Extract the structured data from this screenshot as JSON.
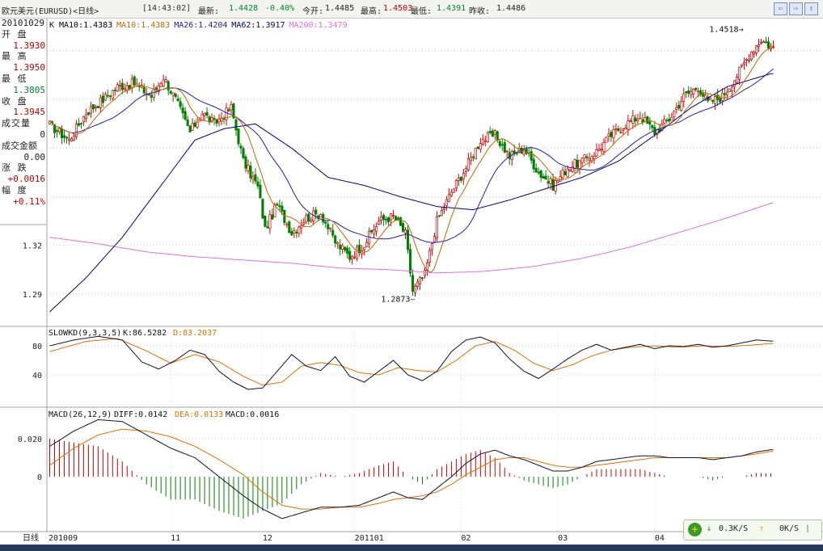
{
  "header": {
    "symbol": "欧元美元(EURUSD)<日线>",
    "time": "[14:43:02]",
    "latest_label": "最新:",
    "latest": "1.4428",
    "change": "-0.40%",
    "open_label": "今开:",
    "open": "1.4485",
    "high_label": "最高:",
    "high": "1.4503",
    "low_label": "最低:",
    "low": "1.4391",
    "prev_close_label": "昨收:",
    "prev_close": "1.4486"
  },
  "window_buttons": [
    "⇦",
    "⇨",
    "⇧"
  ],
  "info_panel": {
    "date": "20101029",
    "open_label": "开 盘",
    "open": "1.3930",
    "high_label": "最 高",
    "high": "1.3950",
    "low_label": "最 低",
    "low": "1.3805",
    "close_label": "收 盘",
    "close": "1.3945",
    "volume_label": "成交量",
    "volume": "0",
    "amount_label": "成交金额",
    "amount": "0.00",
    "change_label": "涨 跌",
    "change": "+0.0016",
    "range_label": "幅 度",
    "range": "+0.11%"
  },
  "colors": {
    "up": "#d40000",
    "down": "#008000",
    "ma10": "#c86400",
    "ma26": "#2222aa",
    "ma62": "#000080",
    "ma200": "#e070e0",
    "k_line": "#111133",
    "d_line": "#e07000"
  },
  "net_widget": {
    "icon": "plus-icon",
    "down_arrow": "↓",
    "down_speed": "0.3K/S",
    "up_arrow": "↑",
    "up_speed": "0K/S",
    "sep": "|"
  },
  "chart_data": [
    {
      "type": "candlestick",
      "legend_prefix": "K",
      "legend": [
        {
          "name": "MA10",
          "value": "1.4383",
          "color": "#000000"
        },
        {
          "name": "MA10",
          "value": "1.4383",
          "color": "#c86400"
        },
        {
          "name": "MA26",
          "value": "1.4204",
          "color": "#2222aa"
        },
        {
          "name": "MA62",
          "value": "1.3917",
          "color": "#000080"
        },
        {
          "name": "MA200",
          "value": "1.3479",
          "color": "#e070e0"
        }
      ],
      "y_ticks": [
        "1.32",
        "1.29"
      ],
      "ylim": [
        1.27,
        1.46
      ],
      "annotations": [
        {
          "text": "1.4518",
          "x": 290,
          "y": 1.4518
        },
        {
          "text": "1.2873",
          "x": 150,
          "y": 1.2873
        }
      ],
      "x_labels": [
        {
          "text": "日线",
          "x": 0
        },
        {
          "text": "201009",
          "x": 0
        },
        {
          "text": "11",
          "x": 50
        },
        {
          "text": "12",
          "x": 88
        },
        {
          "text": "201101",
          "x": 126
        },
        {
          "text": "02",
          "x": 170
        },
        {
          "text": "03",
          "x": 210
        },
        {
          "text": "04",
          "x": 250
        }
      ],
      "close_anchors": [
        [
          0,
          1.3945
        ],
        [
          8,
          1.385
        ],
        [
          15,
          1.402
        ],
        [
          22,
          1.41
        ],
        [
          28,
          1.418
        ],
        [
          35,
          1.42
        ],
        [
          42,
          1.412
        ],
        [
          47,
          1.424
        ],
        [
          52,
          1.41
        ],
        [
          58,
          1.39
        ],
        [
          63,
          1.402
        ],
        [
          68,
          1.395
        ],
        [
          75,
          1.405
        ],
        [
          80,
          1.372
        ],
        [
          86,
          1.356
        ],
        [
          89,
          1.33
        ],
        [
          94,
          1.345
        ],
        [
          100,
          1.328
        ],
        [
          106,
          1.337
        ],
        [
          112,
          1.34
        ],
        [
          118,
          1.322
        ],
        [
          124,
          1.313
        ],
        [
          130,
          1.321
        ],
        [
          136,
          1.335
        ],
        [
          142,
          1.338
        ],
        [
          147,
          1.327
        ],
        [
          150,
          1.292
        ],
        [
          155,
          1.302
        ],
        [
          160,
          1.335
        ],
        [
          166,
          1.353
        ],
        [
          172,
          1.368
        ],
        [
          178,
          1.385
        ],
        [
          184,
          1.388
        ],
        [
          190,
          1.375
        ],
        [
          196,
          1.38
        ],
        [
          202,
          1.365
        ],
        [
          208,
          1.357
        ],
        [
          214,
          1.368
        ],
        [
          220,
          1.372
        ],
        [
          226,
          1.378
        ],
        [
          232,
          1.388
        ],
        [
          238,
          1.395
        ],
        [
          244,
          1.4
        ],
        [
          250,
          1.39
        ],
        [
          256,
          1.398
        ],
        [
          262,
          1.412
        ],
        [
          268,
          1.418
        ],
        [
          272,
          1.408
        ],
        [
          278,
          1.412
        ],
        [
          284,
          1.425
        ],
        [
          290,
          1.44
        ],
        [
          294,
          1.447
        ],
        [
          298,
          1.4428
        ]
      ],
      "ma62_anchors": [
        [
          0,
          1.279
        ],
        [
          15,
          1.3
        ],
        [
          30,
          1.325
        ],
        [
          45,
          1.355
        ],
        [
          60,
          1.385
        ],
        [
          72,
          1.392
        ],
        [
          85,
          1.395
        ],
        [
          100,
          1.38
        ],
        [
          115,
          1.362
        ],
        [
          130,
          1.357
        ],
        [
          145,
          1.35
        ],
        [
          160,
          1.344
        ],
        [
          175,
          1.342
        ],
        [
          190,
          1.348
        ],
        [
          205,
          1.355
        ],
        [
          220,
          1.362
        ],
        [
          235,
          1.372
        ],
        [
          250,
          1.388
        ],
        [
          265,
          1.405
        ],
        [
          280,
          1.418
        ],
        [
          298,
          1.426
        ]
      ],
      "ma200_anchors": [
        [
          0,
          1.325
        ],
        [
          20,
          1.321
        ],
        [
          40,
          1.316
        ],
        [
          60,
          1.313
        ],
        [
          80,
          1.311
        ],
        [
          100,
          1.309
        ],
        [
          120,
          1.306
        ],
        [
          140,
          1.305
        ],
        [
          160,
          1.303
        ],
        [
          180,
          1.304
        ],
        [
          200,
          1.307
        ],
        [
          220,
          1.312
        ],
        [
          240,
          1.319
        ],
        [
          260,
          1.328
        ],
        [
          280,
          1.337
        ],
        [
          298,
          1.346
        ]
      ]
    },
    {
      "type": "line",
      "title": "SLOWKD(9,3,3,5)",
      "series": [
        {
          "name": "K",
          "value": "86.5282"
        },
        {
          "name": "D",
          "value": "83.2037"
        }
      ],
      "y_ticks": [
        "80",
        "40"
      ],
      "ylim": [
        0,
        100
      ],
      "k_anchors": [
        [
          0,
          80
        ],
        [
          10,
          88
        ],
        [
          20,
          93
        ],
        [
          30,
          88
        ],
        [
          38,
          58
        ],
        [
          45,
          48
        ],
        [
          52,
          60
        ],
        [
          58,
          74
        ],
        [
          64,
          68
        ],
        [
          70,
          45
        ],
        [
          76,
          30
        ],
        [
          82,
          20
        ],
        [
          88,
          22
        ],
        [
          94,
          45
        ],
        [
          100,
          68
        ],
        [
          106,
          52
        ],
        [
          112,
          46
        ],
        [
          118,
          65
        ],
        [
          124,
          38
        ],
        [
          130,
          30
        ],
        [
          136,
          45
        ],
        [
          142,
          60
        ],
        [
          148,
          40
        ],
        [
          154,
          32
        ],
        [
          160,
          45
        ],
        [
          166,
          72
        ],
        [
          172,
          88
        ],
        [
          178,
          92
        ],
        [
          184,
          84
        ],
        [
          190,
          62
        ],
        [
          196,
          45
        ],
        [
          202,
          35
        ],
        [
          208,
          48
        ],
        [
          214,
          62
        ],
        [
          220,
          74
        ],
        [
          226,
          82
        ],
        [
          232,
          74
        ],
        [
          238,
          78
        ],
        [
          244,
          82
        ],
        [
          250,
          76
        ],
        [
          256,
          80
        ],
        [
          262,
          79
        ],
        [
          268,
          82
        ],
        [
          274,
          78
        ],
        [
          280,
          80
        ],
        [
          286,
          84
        ],
        [
          292,
          88
        ],
        [
          298,
          86.5
        ]
      ],
      "d_anchors": [
        [
          0,
          72
        ],
        [
          15,
          86
        ],
        [
          28,
          90
        ],
        [
          40,
          73
        ],
        [
          50,
          56
        ],
        [
          60,
          68
        ],
        [
          70,
          58
        ],
        [
          80,
          38
        ],
        [
          88,
          26
        ],
        [
          96,
          30
        ],
        [
          104,
          52
        ],
        [
          112,
          57
        ],
        [
          120,
          53
        ],
        [
          128,
          43
        ],
        [
          136,
          40
        ],
        [
          144,
          50
        ],
        [
          152,
          46
        ],
        [
          160,
          44
        ],
        [
          168,
          60
        ],
        [
          176,
          80
        ],
        [
          184,
          86
        ],
        [
          192,
          74
        ],
        [
          200,
          56
        ],
        [
          208,
          46
        ],
        [
          216,
          54
        ],
        [
          224,
          66
        ],
        [
          232,
          74
        ],
        [
          240,
          78
        ],
        [
          250,
          80
        ],
        [
          260,
          78
        ],
        [
          270,
          80
        ],
        [
          280,
          79
        ],
        [
          290,
          81
        ],
        [
          298,
          83.2
        ]
      ]
    },
    {
      "type": "line+bar",
      "title": "MACD(26,12,9)",
      "series": [
        {
          "name": "DIFF",
          "value": "0.0142"
        },
        {
          "name": "DEA",
          "value": "0.0133"
        },
        {
          "name": "MACD",
          "value": "0.0016"
        }
      ],
      "y_ticks": [
        "0.020",
        "0"
      ],
      "ylim": [
        -0.028,
        0.034
      ],
      "diff_anchors": [
        [
          0,
          0.016
        ],
        [
          10,
          0.024
        ],
        [
          20,
          0.03
        ],
        [
          30,
          0.029
        ],
        [
          40,
          0.022
        ],
        [
          50,
          0.015
        ],
        [
          60,
          0.01
        ],
        [
          70,
          0.0
        ],
        [
          80,
          -0.01
        ],
        [
          88,
          -0.017
        ],
        [
          96,
          -0.022
        ],
        [
          104,
          -0.019
        ],
        [
          112,
          -0.016
        ],
        [
          120,
          -0.016
        ],
        [
          128,
          -0.015
        ],
        [
          136,
          -0.011
        ],
        [
          142,
          -0.008
        ],
        [
          148,
          -0.011
        ],
        [
          154,
          -0.012
        ],
        [
          160,
          -0.006
        ],
        [
          166,
          0.0
        ],
        [
          172,
          0.007
        ],
        [
          178,
          0.012
        ],
        [
          184,
          0.014
        ],
        [
          190,
          0.011
        ],
        [
          196,
          0.009
        ],
        [
          202,
          0.006
        ],
        [
          208,
          0.003
        ],
        [
          214,
          0.003
        ],
        [
          220,
          0.005
        ],
        [
          226,
          0.008
        ],
        [
          232,
          0.009
        ],
        [
          238,
          0.01
        ],
        [
          244,
          0.011
        ],
        [
          250,
          0.011
        ],
        [
          256,
          0.01
        ],
        [
          262,
          0.01
        ],
        [
          268,
          0.01
        ],
        [
          274,
          0.009
        ],
        [
          280,
          0.01
        ],
        [
          286,
          0.011
        ],
        [
          292,
          0.013
        ],
        [
          298,
          0.0142
        ]
      ],
      "dea_anchors": [
        [
          0,
          0.006
        ],
        [
          10,
          0.015
        ],
        [
          20,
          0.022
        ],
        [
          30,
          0.025
        ],
        [
          40,
          0.024
        ],
        [
          50,
          0.021
        ],
        [
          60,
          0.016
        ],
        [
          70,
          0.009
        ],
        [
          80,
          0.001
        ],
        [
          88,
          -0.008
        ],
        [
          96,
          -0.015
        ],
        [
          104,
          -0.017
        ],
        [
          112,
          -0.017
        ],
        [
          120,
          -0.016
        ],
        [
          128,
          -0.016
        ],
        [
          136,
          -0.014
        ],
        [
          142,
          -0.012
        ],
        [
          148,
          -0.011
        ],
        [
          154,
          -0.01
        ],
        [
          160,
          -0.008
        ],
        [
          166,
          -0.004
        ],
        [
          172,
          0.001
        ],
        [
          178,
          0.005
        ],
        [
          184,
          0.009
        ],
        [
          190,
          0.01
        ],
        [
          196,
          0.01
        ],
        [
          202,
          0.008
        ],
        [
          208,
          0.006
        ],
        [
          214,
          0.005
        ],
        [
          220,
          0.005
        ],
        [
          226,
          0.006
        ],
        [
          232,
          0.007
        ],
        [
          238,
          0.008
        ],
        [
          244,
          0.009
        ],
        [
          250,
          0.01
        ],
        [
          256,
          0.01
        ],
        [
          262,
          0.01
        ],
        [
          268,
          0.01
        ],
        [
          274,
          0.01
        ],
        [
          280,
          0.01
        ],
        [
          286,
          0.011
        ],
        [
          292,
          0.012
        ],
        [
          298,
          0.0133
        ]
      ]
    }
  ]
}
